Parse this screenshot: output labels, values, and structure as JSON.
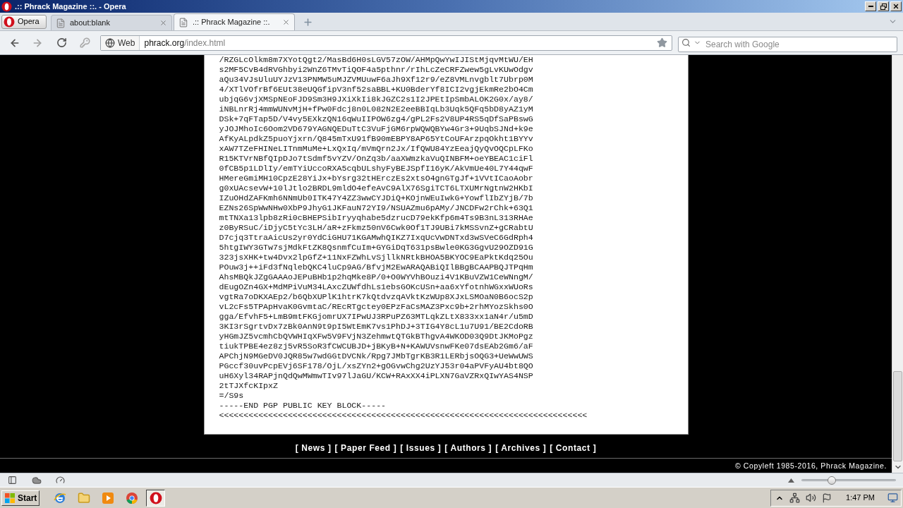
{
  "window": {
    "title": ".:: Phrack Magazine ::. - Opera"
  },
  "menu_button": {
    "label": "Opera"
  },
  "tabs": [
    {
      "label": "about:blank",
      "selected": false
    },
    {
      "label": ".:: Phrack Magazine ::.",
      "selected": true
    }
  ],
  "address_bar": {
    "web_button": "Web",
    "url_host": "phrack.org",
    "url_path": "/index.html"
  },
  "search": {
    "placeholder": "Search with Google"
  },
  "page": {
    "lines": [
      "/RZGLcOlkm8m7XYotQgt2/MasBd6H0sLGV57zOW/AHMpQwYwIJIStMjqvMtWU/EH",
      "s2MF5CvB4dRVGhbyi2WnZ6TMvTiQOF4a5pthnr/rIhLcZeCRFZwew5gLvKUwOdgv",
      "aQu34VJsUluUYJzV13PNMW5uMJZVMUuwF6aJh9Xf12r9/eZ8VMLnvgblt7Ubrp0M",
      "4/XTlVOfrBf6EUt38eUQGfipV3nf52saBBL+KU0BderYf8ICI2vgjEkmRe2bO4Cm",
      "ubjqG6vjXMSpNEoFJD9Sm3H9JXiXkIi8kJGZC2s1I2JPEtIpSmbALOK2G0x/ay8/",
      "iNBLnrRj4mmWUNvMjH+fPw0Fdcj8n0L082N2E2eeBBIqLb3Uqk5QFq5bD8yAZ1yM",
      "DSk+7qFTap5D/V4vy5EXkzQN16qWuIIPOW6zg4/gPL2Fs2V8UP4RS5qDfSaPBswG",
      "yJOJMhoIc6Oom2VD679YAGNQEDuTtC3VuFjGM6rpWQWQBYw4Gr3+9UqbSJNd+k9e",
      "AfKyALpdkZ5puoYjxrn/Q845mTxU91fB90mEBPY8AP65YtCoUFArzpqOkht1BYYv",
      "xAW7TZeFHINeLITnmMuMe+LxQxIq/mVmQrn2Jx/IfQWU84YzEeajQyQvOQCpLFKo",
      "R15KTVrNBfQIpDJo7tSdmf5vYZV/OnZq3b/aaXWmzkaVuQINBFM+oeYBEAC1ciFl",
      "0fCB5p1LDlIy/emTYiUccoRXA5cqbULshyFyBEJSpfI16yK/AkVmUe40L7Y44qwF",
      "HMereGmiMH10CpzE28YiJx+bYsrg32tHErczEs2xtsO4gnGTgJf+1VVtICaoAobr",
      "g0xUAcsevW+10lJtlo2BRDL9mldO4efeAvC9AlX76SgiTCT6LTXUMrNgtnW2HKbI",
      "IZuOHdZAFKmh6NNmUb0ITK47Y4ZZ3wwCYJDiQ+KOjnWEuIwkG+YowflIbZYjB/7b",
      "EZNs26SpWwNHw0XbP9JhyG1JKFauN72YI9/NSUAZmu6pAMy/JNCDFw2rChk+63Q1",
      "mtTNXa13lpb8zRi0cBHEPSibIryyqhabe5dzrucD79ekKfp6m4Ts9B3nL313RHAe",
      "z0ByRSuC/iDjyC5tYc3LH/aR+zFkmz50nV6Cwk0Of1TJ9UBi7kMSSvnZ+gCRabtU",
      "D7cjq3TtraAicUs2yr0YdCiGHU71KGAMwhQIKZ7IxqUcVwDNTxd3wSVeC6GdRph4",
      "5htgIWY3GTw7sjMdkFtZK8QsnmfCuIm+GYGiDqT631psBwle0KG3GgvU29OZD91G",
      "323jsXHK+tw4Dvx2lpGfZ+11NxFZWhLvSjllkNRtkBHOA5BKYOC9EaPktKdq25Ou",
      "POuw3j++iFd3fNqlebQKC4luCp9AG/BfvjM2EwARAQABiQIlBBgBCAAPBQJTPqHm",
      "AhsMBQkJZgGAAAoJEPuBHb1p2hqMke8P/0+O0WYVhBOuzi4V1KBuVZW1CeWNngM/",
      "dEugOZn4GX+MdMPiVuM34LAxcZUWfdhLs1ebsGOKcUSn+aa6xYfotnhWGxxWUoRs",
      "vgtRa7oDKXAEp2/b6QbXUPlK1htrK7kQtdvzqAVktKzWUp8XJxLSMOaN0B6ocS2p",
      "vL2cFs5TPApHvaK0GvmtaC/REcRTgctey0EPzFaCsMAZ3Pxc9b+2rhMYozSkhs0O",
      "gga/EfvhF5+LmB9mtFKGjomrUX7IPwUJ3RPuPZ63MTLqkZLtX833xx1aN4r/u5mD",
      "3KI3rSgrtvDx7zBk0AnN9t9pI5WtEmK7vs1PhDJ+3TIG4Y8cL1u7U91/BE2CdoRB",
      "yHGmJZ5vcmhCbQVWHIqXFw5V9FVjN3ZehmwtQTGkBThgvA4WKOD03Q9DtJKMoPgz",
      "tiukTPBE4ez8zj5vR5SoR3fCWCUBJD+jBKyB+N+KAWUVsnwFKe07dsEAb2Gm6/aF",
      "APChjN9MGeDV0JQR85w7wdGGtDVCNk/Rpg7JMbTgrKB3R1LERbjsOQG3+UeWwUWS",
      "PGccf30uvPcpEVj6SF178/OjL/xsZYn2+gOGvwChg2UzYJ53r04aPVFyAU4bt8QO",
      "uH6Xyl34RAPjnQdQwMWmwTIv97lJaGU/KCW+RAxXX4iPLXN7GaVZRxQIwYAS4NSP",
      "2tTJXfcKIpxZ",
      "=/S9s",
      "-----END PGP PUBLIC KEY BLOCK-----",
      "<<<<<<<<<<<<<<<<<<<<<<<<<<<<<<<<<<<<<<<<<<<<<<<<<<<<<<<<<<<<<<<<<<<<<<<<<<<"
    ],
    "nav_links": [
      "[ News ]",
      "[ Paper Feed ]",
      "[ Issues ]",
      "[ Authors ]",
      "[ Archives ]",
      "[ Contact ]"
    ],
    "copyright": "© Copyleft 1985-2016, Phrack Magazine."
  },
  "status_bar": {
    "zoom_slider": {
      "level": 0.32
    }
  },
  "taskbar": {
    "start": "Start",
    "apps": [
      {
        "selected": false
      },
      {
        "selected": false
      },
      {
        "selected": false
      },
      {
        "selected": false
      },
      {
        "selected": true
      }
    ],
    "clock": "1:47 PM"
  }
}
